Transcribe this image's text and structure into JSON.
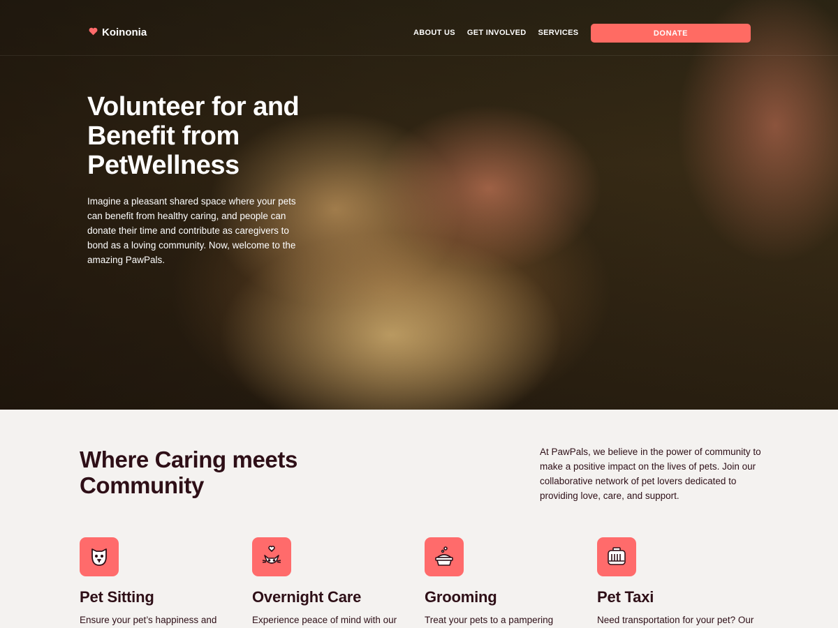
{
  "brand": {
    "name": "Koinonia",
    "icon": "heart-icon",
    "accent": "#ff6b6b"
  },
  "nav": {
    "links": [
      "ABOUT US",
      "GET INVOLVED",
      "SERVICES"
    ],
    "donate_label": "DONATE"
  },
  "hero": {
    "title": "Volunteer for and Benefit from PetWellness",
    "text": "Imagine a pleasant shared space where your pets can benefit from healthy caring, and people can donate their time and contribute as caregivers to bond as a loving community. Now, welcome to the amazing PawPals."
  },
  "section": {
    "title": "Where Caring meets Community",
    "text": "At PawPals, we believe in the power of community to make a positive impact on the lives of pets. Join our collaborative network of pet lovers dedicated to providing love, care, and support."
  },
  "services": [
    {
      "title": "Pet Sitting",
      "desc": "Ensure your pet’s happiness and",
      "icon": "dog-face-icon"
    },
    {
      "title": "Overnight Care",
      "desc": "Experience peace of mind with our",
      "icon": "cat-heart-icon"
    },
    {
      "title": "Grooming",
      "desc": "Treat your pets to a pampering",
      "icon": "pet-bath-icon"
    },
    {
      "title": "Pet Taxi",
      "desc": "Need transportation for your pet? Our",
      "icon": "pet-carrier-icon"
    }
  ],
  "colors": {
    "dark_text": "#2e0f17",
    "background": "#f4f2f0",
    "donate": "#ff6b63"
  }
}
